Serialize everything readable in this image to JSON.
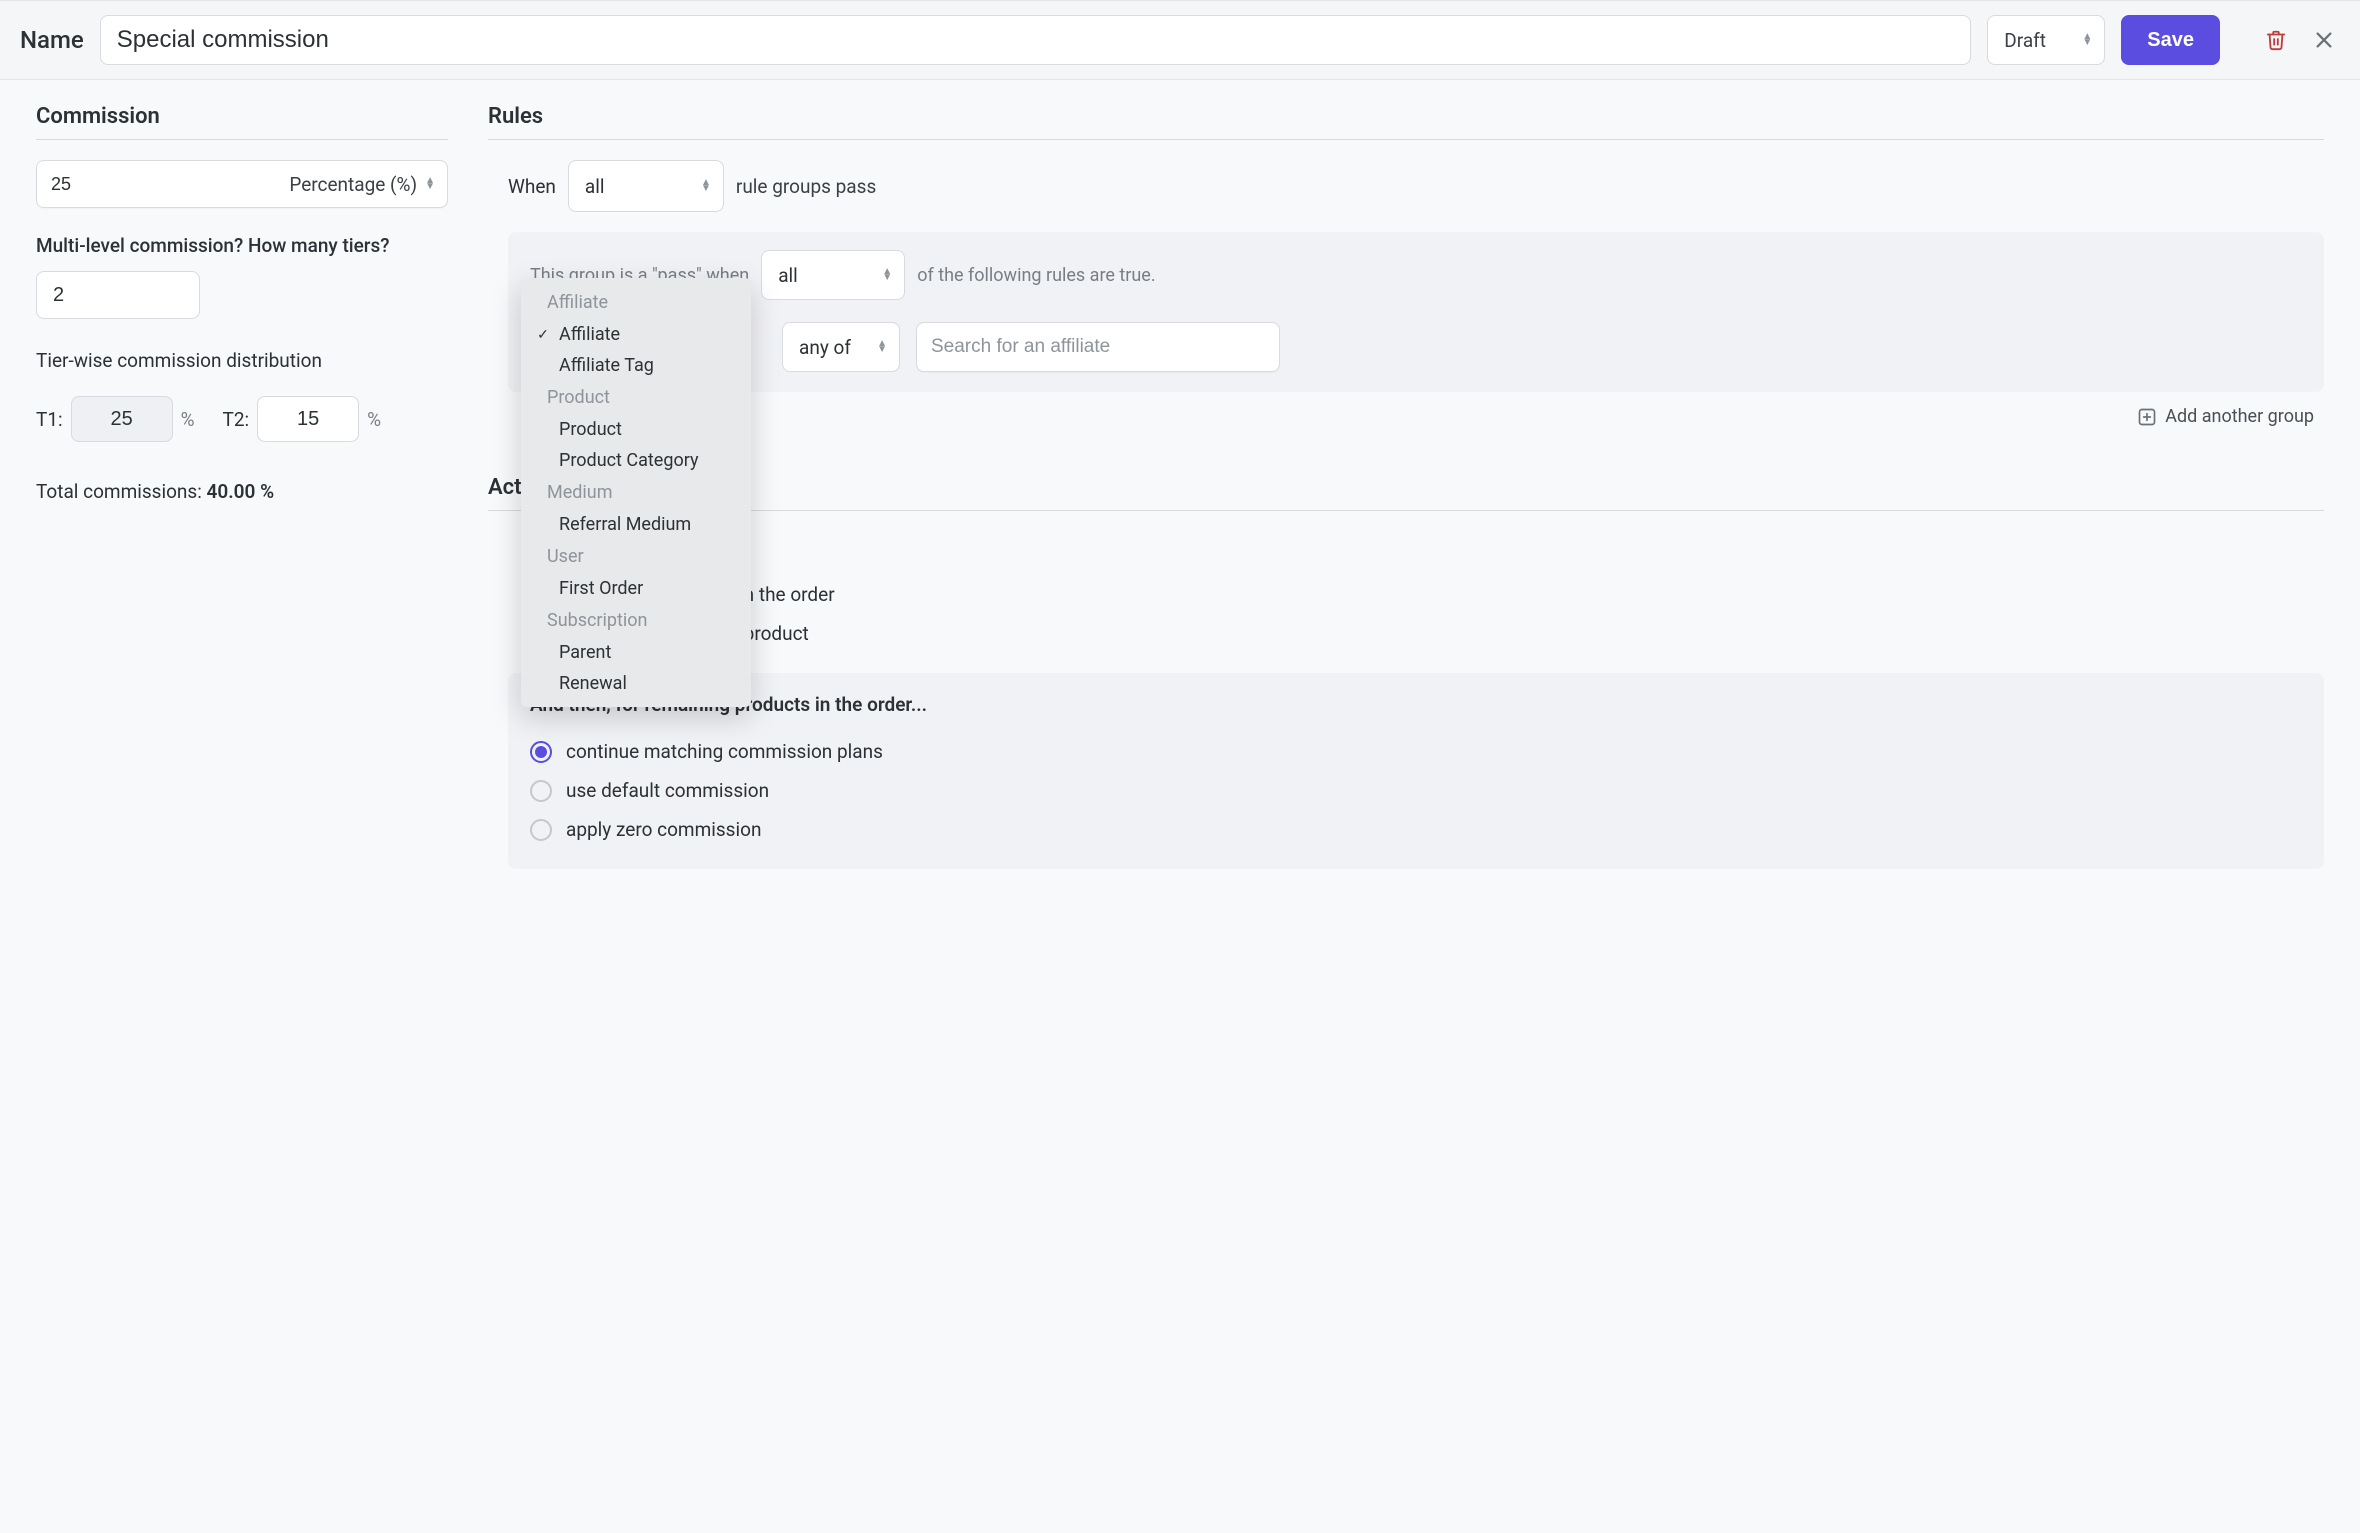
{
  "header": {
    "name_label": "Name",
    "name_value": "Special commission",
    "status": "Draft",
    "save_label": "Save"
  },
  "commission": {
    "title": "Commission",
    "amount_value": "25",
    "amount_type": "Percentage (%)",
    "tiers_question": "Multi-level commission? How many tiers?",
    "tiers_value": "2",
    "dist_label": "Tier-wise commission distribution",
    "t1_label": "T1:",
    "t1_value": "25",
    "t2_label": "T2:",
    "t2_value": "15",
    "pct": "%",
    "totals_label": "Total commissions: ",
    "totals_value": "40.00 %"
  },
  "rules": {
    "title": "Rules",
    "when_label": "When",
    "when_value": "all",
    "when_tail": "rule groups pass",
    "group_head_pre": "This group is a \"pass\" when",
    "group_head_value": "all",
    "group_head_post": "of the following rules are true.",
    "operator_value": "any of",
    "affiliate_placeholder": "Search for an affiliate",
    "add_group_label": "Add another group",
    "dropdown": {
      "groups": [
        {
          "label": "Affiliate",
          "items": [
            "Affiliate",
            "Affiliate Tag"
          ],
          "selected": "Affiliate"
        },
        {
          "label": "Product",
          "items": [
            "Product",
            "Product Category"
          ]
        },
        {
          "label": "Medium",
          "items": [
            "Referral Medium"
          ]
        },
        {
          "label": "User",
          "items": [
            "First Order"
          ]
        },
        {
          "label": "Subscription",
          "items": [
            "Parent",
            "Renewal"
          ]
        }
      ]
    }
  },
  "actions": {
    "title": "Actions",
    "partial_tail_1": "n the order",
    "partial_tail_2": "product",
    "then_intro": "And then, for remaining products in the order...",
    "options": [
      {
        "label": "continue matching commission plans",
        "checked": true
      },
      {
        "label": "use default commission",
        "checked": false
      },
      {
        "label": "apply zero commission",
        "checked": false
      }
    ]
  }
}
